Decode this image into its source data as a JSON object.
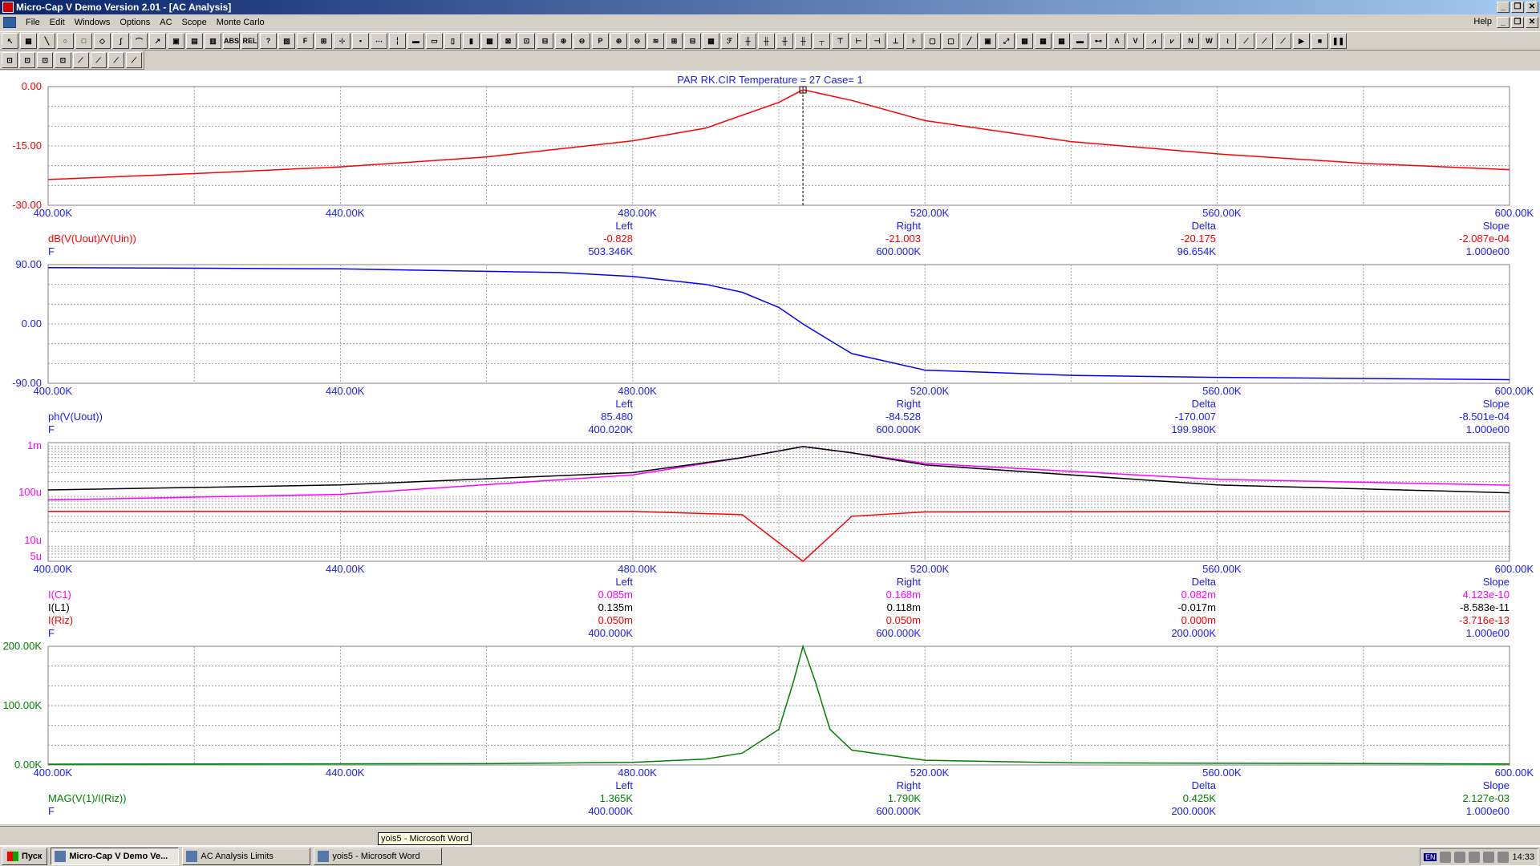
{
  "window": {
    "title": "Micro-Cap V Demo Version 2.01 - [AC Analysis]",
    "controls": [
      "_",
      "❐",
      "✕"
    ]
  },
  "menu": {
    "items": [
      "File",
      "Edit",
      "Windows",
      "Options",
      "AC",
      "Scope",
      "Monte Carlo"
    ],
    "help": "Help"
  },
  "toolbar": {
    "row1": [
      "↖",
      "▦",
      "╲",
      "○",
      "□",
      "◇",
      "∫",
      "⌒",
      "↗",
      "▣",
      "▤",
      "▥",
      "ABS",
      "REL",
      "?",
      "▧",
      "F",
      "⊞",
      "⊹",
      "▪",
      "⋯",
      "╎",
      "▬",
      "▭",
      "▯",
      "▮",
      "▩",
      "⊠",
      "⊡",
      "⊟",
      "⊕",
      "⊖",
      "P",
      "⊕",
      "⊖",
      "≋",
      "⊞",
      "⊟",
      "▦",
      "ℱ",
      "╫",
      "╫",
      "╫",
      "╫",
      "┬",
      "⊤",
      "⊢",
      "⊣",
      "⊥",
      "⊦",
      "▢",
      "▢",
      "╱",
      "▣",
      "⤢",
      "▦",
      "▦",
      "▦",
      "▬",
      "⊷",
      "Λ",
      "V",
      "⩘",
      "⩗",
      "N",
      "W",
      "≀",
      "⟋",
      "⟋",
      "⟋",
      "▶",
      "■",
      "❚❚"
    ],
    "row2": [
      "⊡",
      "⊡",
      "⊡",
      "⊡",
      "⟋",
      "⟋",
      "⟋",
      "⟋"
    ]
  },
  "plot_title": "PAR  RK.CIR Temperature = 27 Case= 1",
  "x_ticks": [
    "400.00K",
    "440.00K",
    "480.00K",
    "520.00K",
    "560.00K",
    "600.00K"
  ],
  "panels": [
    {
      "y_ticks": [
        "0.00",
        "-15.00",
        "-30.00"
      ],
      "cursor_headers": [
        "Left",
        "Right",
        "Delta",
        "Slope"
      ],
      "rows": [
        {
          "name": "dB(V(Uout)/V(Uin))",
          "left": "-0.828",
          "right": "-21.003",
          "delta": "-20.175",
          "slope": "-2.087e-04"
        },
        {
          "name": "F",
          "left": "503.346K",
          "right": "600.000K",
          "delta": "96.654K",
          "slope": "1.000e00"
        }
      ]
    },
    {
      "y_ticks": [
        "90.00",
        "0.00",
        "-90.00"
      ],
      "cursor_headers": [
        "Left",
        "Right",
        "Delta",
        "Slope"
      ],
      "rows": [
        {
          "name": "ph(V(Uout))",
          "left": "85.480",
          "right": "-84.528",
          "delta": "-170.007",
          "slope": "-8.501e-04"
        },
        {
          "name": "F",
          "left": "400.020K",
          "right": "600.000K",
          "delta": "199.980K",
          "slope": "1.000e00"
        }
      ]
    },
    {
      "y_ticks": [
        "1m",
        "100u",
        "10u",
        "5u"
      ],
      "cursor_headers": [
        "Left",
        "Right",
        "Delta",
        "Slope"
      ],
      "rows": [
        {
          "name": "I(C1)",
          "left": "0.085m",
          "right": "0.168m",
          "delta": "0.082m",
          "slope": "4.123e-10"
        },
        {
          "name": "I(L1)",
          "left": "0.135m",
          "right": "0.118m",
          "delta": "-0.017m",
          "slope": "-8.583e-11"
        },
        {
          "name": "I(Riz)",
          "left": "0.050m",
          "right": "0.050m",
          "delta": "0.000m",
          "slope": "-3.716e-13"
        },
        {
          "name": "F",
          "left": "400.000K",
          "right": "600.000K",
          "delta": "200.000K",
          "slope": "1.000e00"
        }
      ]
    },
    {
      "y_ticks": [
        "200.00K",
        "100.00K",
        "0.00K"
      ],
      "cursor_headers": [
        "Left",
        "Right",
        "Delta",
        "Slope"
      ],
      "rows": [
        {
          "name": "MAG(V(1)/I(Riz))",
          "left": "1.365K",
          "right": "1.790K",
          "delta": "0.425K",
          "slope": "2.127e-03"
        },
        {
          "name": "F",
          "left": "400.000K",
          "right": "600.000K",
          "delta": "200.000K",
          "slope": "1.000e00"
        }
      ]
    }
  ],
  "colors": {
    "dB": "#ff0000",
    "phase": "#0000ff",
    "I_C1": "#ff00ff",
    "I_L1": "#000000",
    "I_Riz": "#ff0000",
    "MAG": "#008000",
    "label": "#1a1aff"
  },
  "chart_data": [
    {
      "type": "line",
      "x": [
        400,
        420,
        440,
        460,
        480,
        490,
        500,
        503.3,
        510,
        520,
        540,
        560,
        580,
        600
      ],
      "series": [
        {
          "name": "dB(V(Uout)/V(Uin))",
          "values": [
            -23.5,
            -22.0,
            -20.3,
            -17.8,
            -13.7,
            -10.5,
            -4.0,
            -0.8,
            -3.5,
            -8.6,
            -13.9,
            -17.0,
            -19.4,
            -21.0
          ]
        }
      ],
      "ylim": [
        -30,
        0
      ]
    },
    {
      "type": "line",
      "x": [
        400,
        440,
        470,
        480,
        490,
        495,
        500,
        503.3,
        507,
        510,
        520,
        540,
        560,
        600
      ],
      "series": [
        {
          "name": "ph(V(Uout))",
          "values": [
            85.5,
            83.5,
            78,
            72,
            60,
            48,
            25,
            0,
            -25,
            -45,
            -70,
            -78,
            -81,
            -84.5
          ]
        }
      ],
      "ylim": [
        -90,
        90
      ]
    },
    {
      "type": "line",
      "x": [
        400,
        440,
        480,
        495,
        503.3,
        510,
        520,
        560,
        600
      ],
      "series": [
        {
          "name": "I(C1)",
          "values": [
            0.085,
            0.11,
            0.27,
            0.6,
            1.0,
            0.75,
            0.46,
            0.22,
            0.168
          ]
        },
        {
          "name": "I(L1)",
          "values": [
            0.135,
            0.17,
            0.3,
            0.6,
            1.0,
            0.75,
            0.43,
            0.17,
            0.118
          ]
        },
        {
          "name": "I(Riz)",
          "values": [
            0.05,
            0.05,
            0.05,
            0.043,
            0.005,
            0.04,
            0.049,
            0.05,
            0.05
          ]
        }
      ],
      "ylim": [
        0.005,
        1.2
      ]
    },
    {
      "type": "line",
      "x": [
        400,
        460,
        480,
        490,
        495,
        500,
        502,
        503.3,
        505,
        507,
        510,
        520,
        540,
        600
      ],
      "series": [
        {
          "name": "MAG(V(1)/I(Riz))",
          "values": [
            1.4,
            2.2,
            4.5,
            10,
            20,
            60,
            140,
            200,
            140,
            60,
            25,
            8,
            3.5,
            1.8
          ]
        }
      ],
      "ylim": [
        0,
        200
      ]
    }
  ],
  "status_tooltip": "yois5 - Microsoft Word",
  "taskbar": {
    "start": "Пуск",
    "tasks": [
      "Micro-Cap V Demo Ve...",
      "AC Analysis Limits",
      "yois5 - Microsoft Word"
    ],
    "lang": "EN",
    "clock": "14:33"
  }
}
